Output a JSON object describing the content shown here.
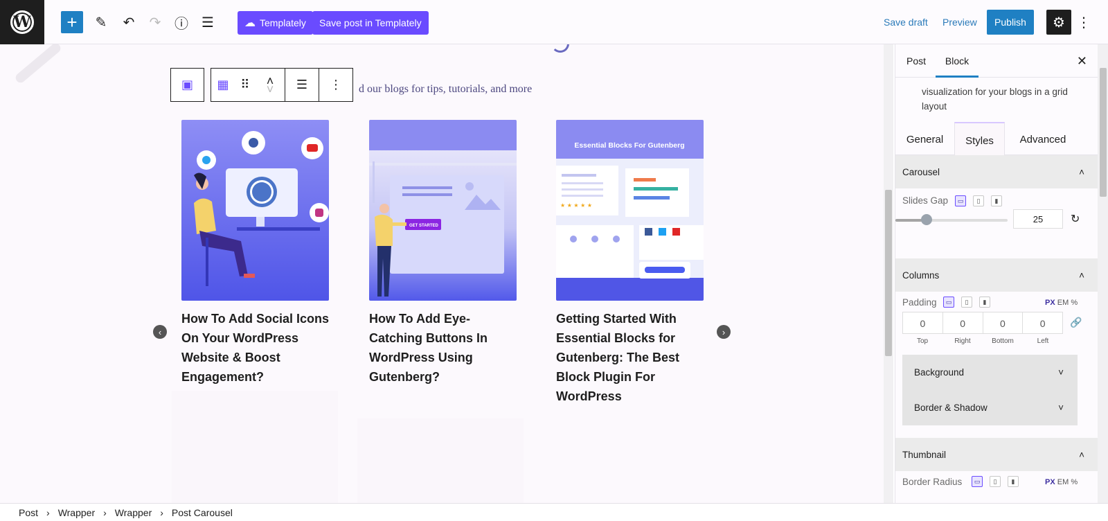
{
  "topbar": {
    "logo": "W",
    "add_icon": "+",
    "edit_icon": "✎",
    "undo_icon": "↶",
    "redo_icon": "↷",
    "info_icon": "ⓘ",
    "list_icon": "☰",
    "templately_label": "Templately",
    "save_templately_label": "Save post in Templately",
    "save_draft_label": "Save draft",
    "preview_label": "Preview",
    "publish_label": "Publish",
    "settings_icon": "⚙",
    "more_icon": "⋮"
  },
  "editor": {
    "subtitle": "d our blogs for tips, tutorials, and more",
    "toolbar": {
      "block_icon": "▣",
      "carousel_icon": "▦",
      "drag_icon": "⠿",
      "up_icon": "˄",
      "down_icon": "˅",
      "align_icon": "☰",
      "more_icon": "⋮"
    },
    "posts": [
      {
        "title": "How To Add Social Icons On Your WordPress Website & Boost Engagement?"
      },
      {
        "title": "How To Add Eye-Catching Buttons In WordPress Using Gutenberg?"
      },
      {
        "title": "Getting Started With Essential Blocks for Gutenberg: The Best Block Plugin For WordPress"
      }
    ],
    "thumb3_heading": "Essential Blocks For Gutenberg",
    "thumb2_button": "GET STARTED",
    "prev_icon": "‹",
    "next_icon": "›"
  },
  "breadcrumb": {
    "items": [
      "Post",
      "Wrapper",
      "Wrapper",
      "Post Carousel"
    ],
    "separator": "›"
  },
  "panel": {
    "tabs": [
      "Post",
      "Block"
    ],
    "close_icon": "✕",
    "description": "visualization for your blogs in a grid layout",
    "style_tabs": [
      "General",
      "Styles",
      "Advanced"
    ],
    "carousel": {
      "title": "Carousel",
      "toggle_icon": "˄",
      "slides_gap_label": "Slides Gap",
      "slides_gap_value": "25",
      "slides_gap_max": 100,
      "reset_icon": "↻"
    },
    "columns": {
      "title": "Columns",
      "toggle_icon": "˄",
      "padding_label": "Padding",
      "units": [
        "PX",
        "EM",
        "%"
      ],
      "padding_values": [
        "0",
        "0",
        "0",
        "0"
      ],
      "padding_labels": [
        "Top",
        "Right",
        "Bottom",
        "Left"
      ],
      "link_icon": "🔗",
      "background_label": "Background",
      "border_shadow_label": "Border & Shadow",
      "chevron_icon": "˅"
    },
    "thumbnail": {
      "title": "Thumbnail",
      "toggle_icon": "˄",
      "border_radius_label": "Border Radius",
      "units": [
        "PX",
        "EM",
        "%"
      ]
    },
    "device_icons": [
      "▭",
      "▯",
      "▮"
    ]
  }
}
